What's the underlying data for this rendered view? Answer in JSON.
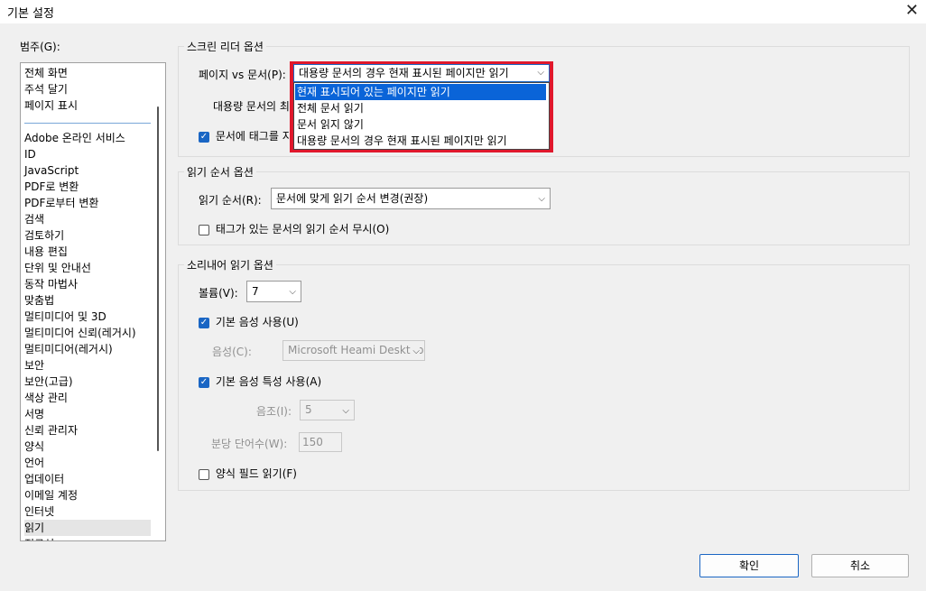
{
  "window": {
    "title": "기본 설정",
    "close_glyph": "✕"
  },
  "sidebar": {
    "label": "범주(G):",
    "items_top": [
      "전체 화면",
      "주석 달기",
      "페이지 표시"
    ],
    "items": [
      "Adobe 온라인 서비스",
      "ID",
      "JavaScript",
      "PDF로 변환",
      "PDF로부터 변환",
      "검색",
      "검토하기",
      "내용 편집",
      "단위 및 안내선",
      "동작 마법사",
      "맞춤법",
      "멀티미디어 및 3D",
      "멀티미디어 신뢰(레거시)",
      "멀티미디어(레거시)",
      "보안",
      "보안(고급)",
      "색상 관리",
      "서명",
      "신뢰 관리자",
      "양식",
      "언어",
      "업데이터",
      "이메일 계정",
      "인터넷",
      "읽기",
      "접근성"
    ],
    "selected": "읽기"
  },
  "screen_reader": {
    "title": "스크린 리더 옵션",
    "page_vs_doc_label": "페이지 vs 문서(P):",
    "page_vs_doc_value": "대용량 문서의 경우 현재 표시된 페이지만 읽기",
    "options": [
      "현재 표시되어 있는 페이지만 읽기",
      "전체 문서 읽기",
      "문서 읽지 않기",
      "대용량 문서의 경우 현재 표시된 페이지만 읽기"
    ],
    "large_doc_label": "대용량 문서의 최",
    "tag_label": "문서에 태그를 지"
  },
  "reading_order": {
    "title": "읽기 순서 옵션",
    "order_label": "읽기 순서(R):",
    "order_value": "문서에 맞게 읽기 순서 변경(권장)",
    "ignore_label": "태그가 있는 문서의 읽기 순서 무시(O)"
  },
  "read_aloud": {
    "title": "소리내어 읽기 옵션",
    "volume_label": "볼륨(V):",
    "volume_value": "7",
    "default_voice_label": "기본 음성 사용(U)",
    "voice_label": "음성(C):",
    "voice_value": "Microsoft Heami Desktop",
    "default_props_label": "기본 음성 특성 사용(A)",
    "pitch_label": "음조(I):",
    "pitch_value": "5",
    "wpm_label": "분당 단어수(W):",
    "wpm_value": "150",
    "form_fields_label": "양식 필드 읽기(F)"
  },
  "buttons": {
    "ok": "확인",
    "cancel": "취소"
  },
  "glyphs": {
    "check": "✓",
    "chevron": "⌵"
  },
  "colors": {
    "highlight_box": "#e0182c",
    "selection": "#0a64d8",
    "checkbox": "#1a66c4"
  }
}
